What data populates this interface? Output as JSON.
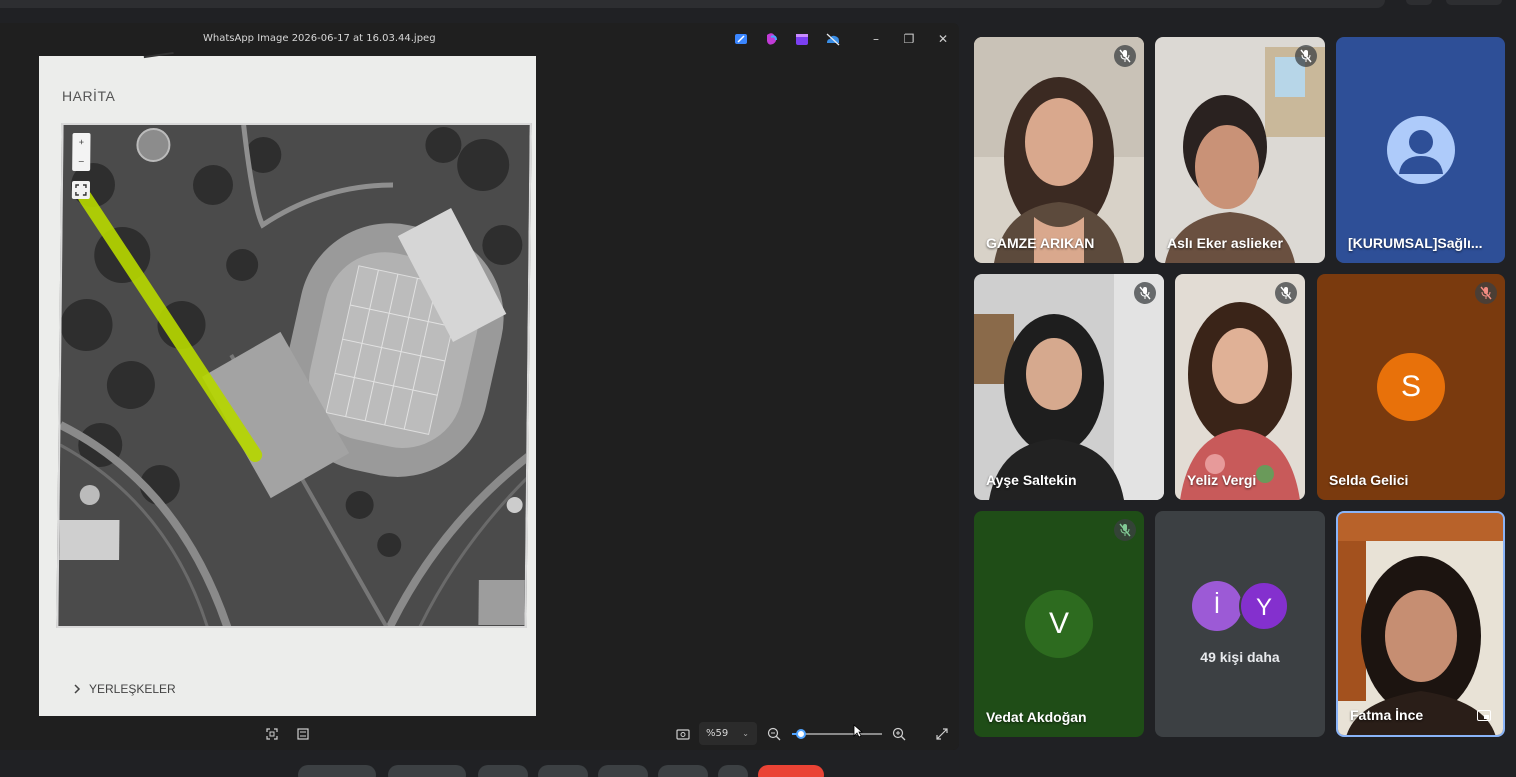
{
  "viewer": {
    "title": "WhatsApp Image 2026-06-17 at 16.03.44.jpeg",
    "window_buttons": [
      "–",
      "❐",
      "✕"
    ],
    "document": {
      "heading": "HARİTA",
      "section_label": "YERLEŞKELER",
      "map_zoom_in": "+",
      "map_zoom_out": "–"
    },
    "footer": {
      "zoom_value": "%59",
      "zoom_fraction": 0.1
    },
    "colors": {
      "highlight": "#b5d600"
    }
  },
  "participants": [
    {
      "name": "GAMZE ARIKAN",
      "muted": true
    },
    {
      "name": "Aslı Eker aslieker",
      "muted": true
    },
    {
      "name": "[KURUMSAL]Sağlı...",
      "muted": false,
      "avatar": "person-icon",
      "bg": "#2e4f97"
    },
    {
      "name": "Ayşe Saltekin",
      "muted": true
    },
    {
      "name": "Yeliz Vergi",
      "muted": true
    },
    {
      "name": "Selda Gelici",
      "muted": true,
      "initial": "S",
      "bg": "#7a3a0e",
      "avatar_color": "#e8710a"
    },
    {
      "name": "Vedat Akdoğan",
      "muted": true,
      "initial": "V",
      "bg": "#1f4d17",
      "avatar_color": "#2d6b1f"
    },
    {
      "more_label": "49 kişi daha",
      "initials": [
        "İ",
        "Y"
      ]
    },
    {
      "name": "Fatma İnce",
      "presenting": true
    }
  ]
}
